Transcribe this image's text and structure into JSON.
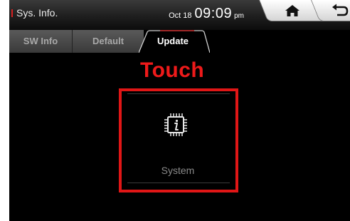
{
  "status_bar": {
    "app_title": "Sys. Info.",
    "date": "Oct 18",
    "time": "09:09",
    "ampm": "pm"
  },
  "icons": {
    "home": "home-icon",
    "back": "back-arrow-icon",
    "tile": "chip-info-icon"
  },
  "tabs": [
    {
      "label": "SW Info",
      "selected": false
    },
    {
      "label": "Default",
      "selected": false
    },
    {
      "label": "Update",
      "selected": true
    }
  ],
  "annotation": {
    "label": "Touch"
  },
  "tiles": [
    {
      "label": "System"
    }
  ],
  "colors": {
    "accent_red": "#e01616",
    "background": "#000000",
    "tab_active_text": "#ffffff"
  }
}
